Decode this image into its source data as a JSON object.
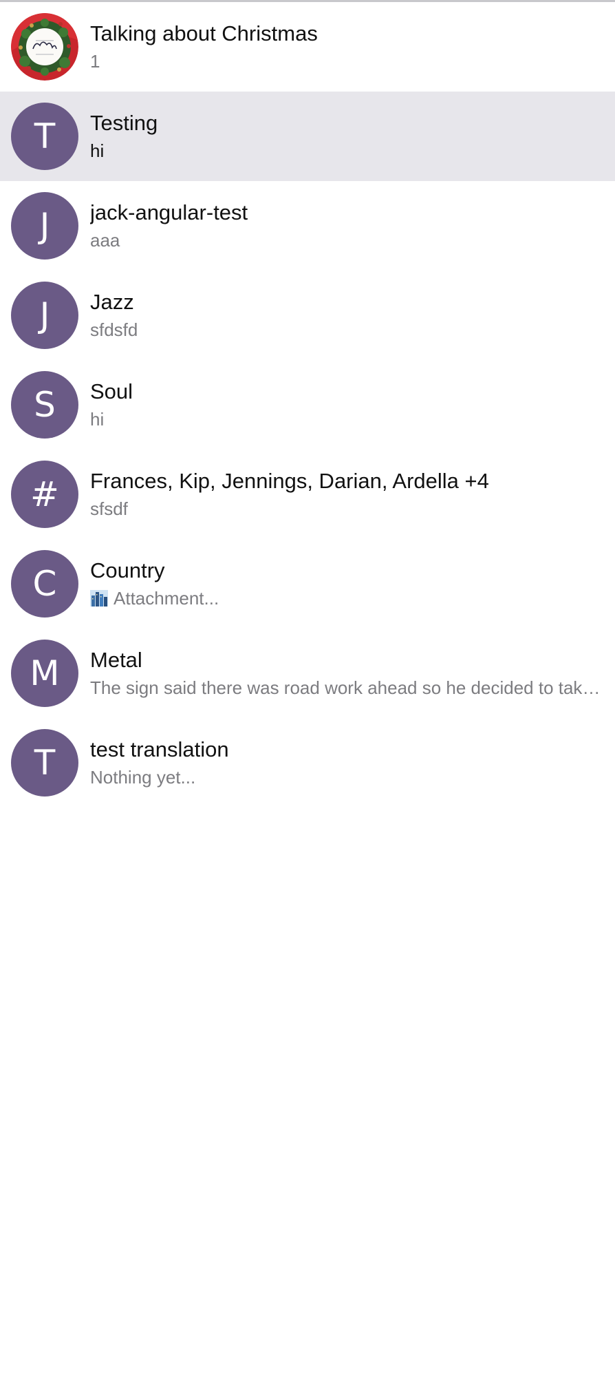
{
  "channels": [
    {
      "avatar": "image",
      "name": "Talking about Christmas",
      "preview": "1",
      "unread": false,
      "selected": false,
      "avatar_text": "Merry Christmas"
    },
    {
      "avatar": "T",
      "name": "Testing",
      "preview": "hi",
      "unread": true,
      "selected": true
    },
    {
      "avatar": "J",
      "name": "jack-angular-test",
      "preview": "aaa",
      "unread": false,
      "selected": false
    },
    {
      "avatar": "J",
      "name": "Jazz",
      "preview": "sfdsfd",
      "unread": false,
      "selected": false
    },
    {
      "avatar": "S",
      "name": "Soul",
      "preview": "hi",
      "unread": false,
      "selected": false
    },
    {
      "avatar": "#",
      "name": "Frances, Kip, Jennings, Darian, Ardella +4",
      "preview": "sfsdf",
      "unread": false,
      "selected": false
    },
    {
      "avatar": "C",
      "name": "Country",
      "preview": "Attachment...",
      "preview_icon": "city-image-icon",
      "unread": false,
      "selected": false
    },
    {
      "avatar": "M",
      "name": "Metal",
      "preview": "The sign said there was road work ahead so he decided to take the detour",
      "unread": false,
      "selected": false
    },
    {
      "avatar": "T",
      "name": "test translation",
      "preview": "Nothing yet...",
      "unread": false,
      "selected": false
    }
  ],
  "colors": {
    "avatar_bg": "#6a5a86",
    "selected_bg": "#e7e6eb",
    "name": "#111111",
    "preview": "#7c7c80"
  }
}
